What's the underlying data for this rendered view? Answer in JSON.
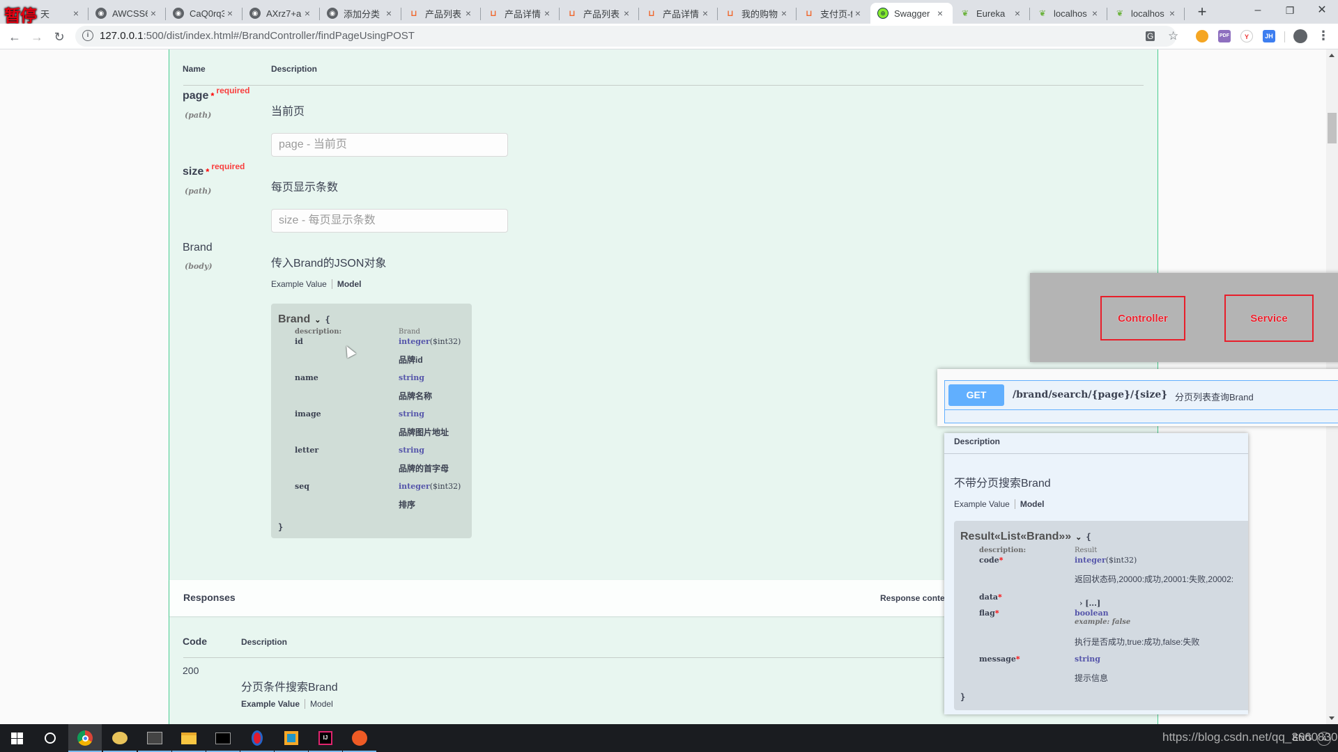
{
  "browser": {
    "pause_badge": "暂停",
    "tabs": [
      {
        "title": "天",
        "icon": "globe-icon",
        "active": false
      },
      {
        "title": "AWCSS6",
        "icon": "globe-icon",
        "active": false
      },
      {
        "title": "CaQ0rq3",
        "icon": "globe-icon",
        "active": false
      },
      {
        "title": "AXrz7+a",
        "icon": "globe-icon",
        "active": false
      },
      {
        "title": "添加分类",
        "icon": "globe-icon",
        "active": false
      },
      {
        "title": "产品列表",
        "icon": "cart-icon",
        "active": false
      },
      {
        "title": "产品详情",
        "icon": "cart-icon",
        "active": false
      },
      {
        "title": "产品列表",
        "icon": "cart-icon",
        "active": false
      },
      {
        "title": "产品详情",
        "icon": "cart-icon",
        "active": false
      },
      {
        "title": "我的购物",
        "icon": "cart-icon",
        "active": false
      },
      {
        "title": "支付页-f",
        "icon": "cart-icon",
        "active": false
      },
      {
        "title": "Swagger",
        "icon": "swagger-icon",
        "active": true
      },
      {
        "title": "Eureka",
        "icon": "spring-leaf-icon",
        "active": false
      },
      {
        "title": "localhos",
        "icon": "spring-leaf-icon",
        "active": false
      },
      {
        "title": "localhos",
        "icon": "spring-leaf-icon",
        "active": false
      }
    ],
    "tab_close_glyph": "×",
    "new_tab_glyph": "+",
    "window_controls": {
      "minimize": "–",
      "maximize": "❐",
      "close": "✕"
    },
    "nav": {
      "back": "←",
      "forward": "→",
      "reload": "↻"
    },
    "url_host": "127.0.0.1",
    "url_rest": ":500/dist/index.html#/BrandController/findPageUsingPOST",
    "info_glyph": "i",
    "extensions": [
      "translate-icon",
      "bookmark-star-icon",
      "orange-ext-icon",
      "pdf-ext-icon",
      "y-ext-icon",
      "jh-ext-icon",
      "profile-icon",
      "menu-icon"
    ],
    "ext_labels": {
      "pdf": "PDF",
      "jh": "JH",
      "y": "Y",
      "star": "☆",
      "translate": "G",
      "menu": "⋮"
    }
  },
  "parameters": {
    "col_name": "Name",
    "col_description": "Description",
    "items": [
      {
        "name": "page",
        "required": true,
        "required_label": "required",
        "in": "(path)",
        "description": "当前页",
        "placeholder": "page - 当前页"
      },
      {
        "name": "size",
        "required": true,
        "required_label": "required",
        "in": "(path)",
        "description": "每页显示条数",
        "placeholder": "size - 每页显示条数"
      },
      {
        "name": "Brand",
        "required": false,
        "in": "(body)",
        "description": "传入Brand的JSON对象"
      }
    ],
    "body_tabs": {
      "example": "Example Value",
      "model": "Model",
      "selected": "Model"
    },
    "model": {
      "title": "Brand",
      "open_brace": "{",
      "close_brace": "}",
      "description_key": "description:",
      "description_value": "Brand",
      "fields": [
        {
          "key": "id",
          "type": "integer",
          "format": "($int32)",
          "desc": "品牌id"
        },
        {
          "key": "name",
          "type": "string",
          "format": "",
          "desc": "品牌名称"
        },
        {
          "key": "image",
          "type": "string",
          "format": "",
          "desc": "品牌图片地址"
        },
        {
          "key": "letter",
          "type": "string",
          "format": "",
          "desc": "品牌的首字母"
        },
        {
          "key": "seq",
          "type": "integer",
          "format": "($int32)",
          "desc": "排序"
        }
      ]
    }
  },
  "responses": {
    "title": "Responses",
    "content_type_label": "Response conte",
    "col_code": "Code",
    "col_description": "Description",
    "rows": [
      {
        "code": "200",
        "description": "分页条件搜索Brand",
        "tabs": {
          "example": "Example Value",
          "model": "Model",
          "selected": "Example Value"
        }
      }
    ]
  },
  "overlay": {
    "boxes": [
      "Controller",
      "Service"
    ],
    "accent_color": "#e81e2a"
  },
  "get_popup": {
    "method": "GET",
    "path": "/brand/search/{page}/{size}",
    "summary": "分页列表查询Brand",
    "method_color": "#61affe"
  },
  "desc_popup": {
    "header": "Description",
    "description": "不带分页搜索Brand",
    "tabs": {
      "example": "Example Value",
      "model": "Model",
      "selected": "Model"
    },
    "model": {
      "title": "Result«List«Brand»»",
      "open_brace": "{",
      "close_brace": "}",
      "description_key": "description:",
      "description_value": "Result",
      "fields": [
        {
          "key": "code",
          "required": true,
          "type": "integer",
          "format": "($int32)",
          "desc": "返回状态码,20000:成功,20001:失败,20002:"
        },
        {
          "key": "data",
          "required": true,
          "type": "[...]",
          "collapsed": true
        },
        {
          "key": "flag",
          "required": true,
          "type": "boolean",
          "example": "example: false",
          "desc": "执行是否成功,true:成功,false:失败"
        },
        {
          "key": "message",
          "required": true,
          "type": "string",
          "desc": "提示信息"
        }
      ]
    }
  },
  "taskbar": {
    "items": [
      "windows-start-icon",
      "cortana-search-icon",
      "chrome-icon",
      "navicat-icon",
      "tool-icon",
      "file-explorer-icon",
      "cmd-icon",
      "app-icon",
      "vmware-icon",
      "intellij-icon",
      "postman-icon"
    ],
    "tray_text": "ENG",
    "notification_count": "4",
    "watermark": "https://blog.csdn.net/qq_36608300"
  },
  "colors": {
    "post_green": "#49cc90",
    "panel_bg": "#e8f6f0",
    "required_red": "#f93e3e"
  }
}
